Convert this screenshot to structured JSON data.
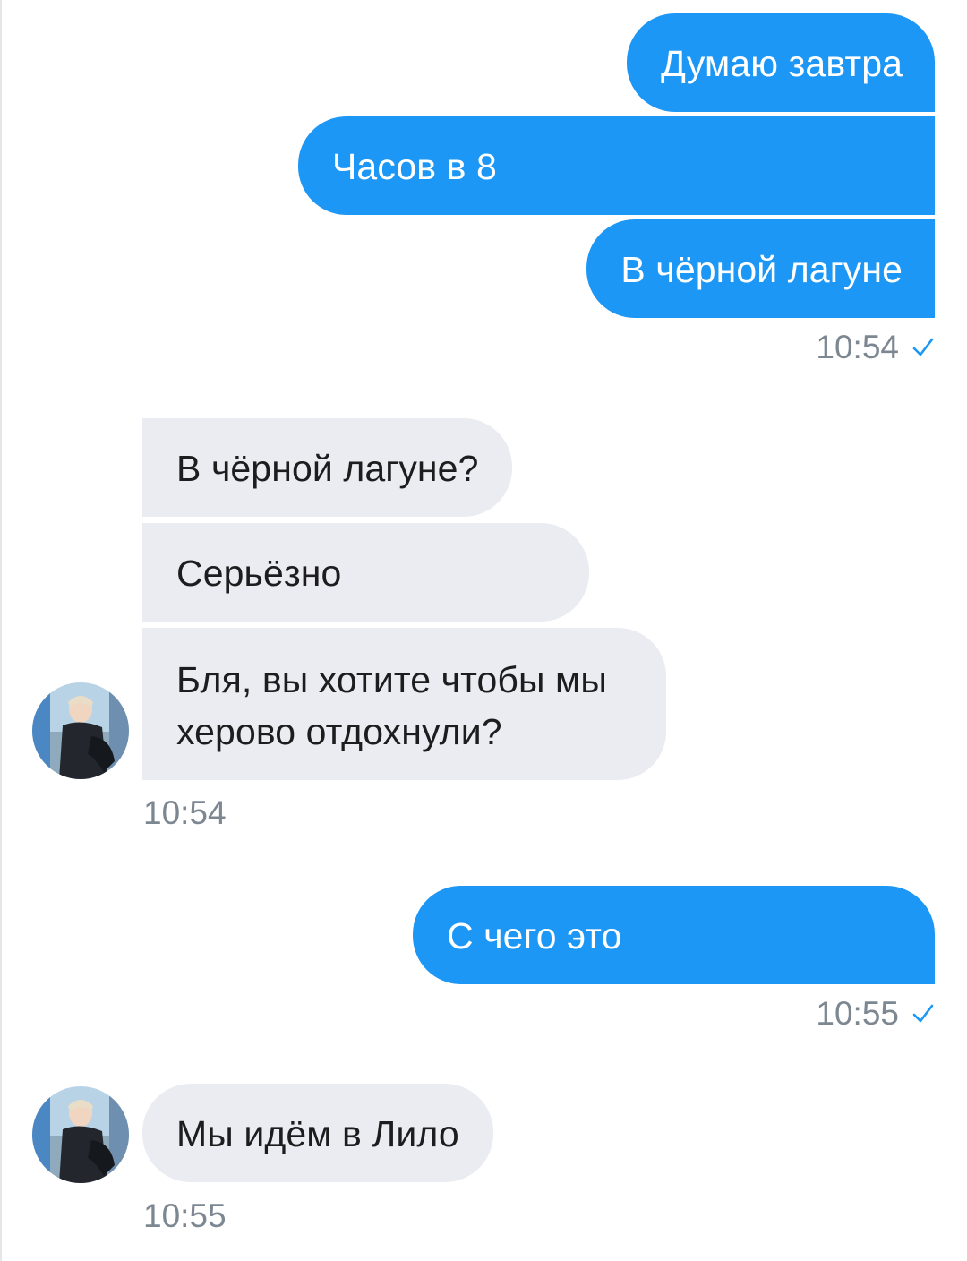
{
  "conversation": {
    "outgoing_group_1": {
      "messages": [
        "Думаю завтра",
        "Часов в 8",
        "В чёрной лагуне"
      ],
      "time": "10:54",
      "status": "sent-check-icon"
    },
    "incoming_group_1": {
      "messages": [
        "В чёрной лагуне?",
        "Серьёзно",
        "Бля, вы хотите чтобы мы",
        "херово отдохнули?"
      ],
      "time": "10:54",
      "avatar": "user-avatar"
    },
    "outgoing_group_2": {
      "messages": [
        "С чего это"
      ],
      "time": "10:55",
      "status": "sent-check-icon"
    },
    "incoming_group_2": {
      "messages": [
        "Мы идём в Лило"
      ],
      "time": "10:55",
      "avatar": "user-avatar"
    }
  },
  "colors": {
    "outgoing_bubble": "#1c97f5",
    "incoming_bubble": "#ebecf1",
    "timestamp": "#7d8792",
    "check": "#1c97f5"
  }
}
